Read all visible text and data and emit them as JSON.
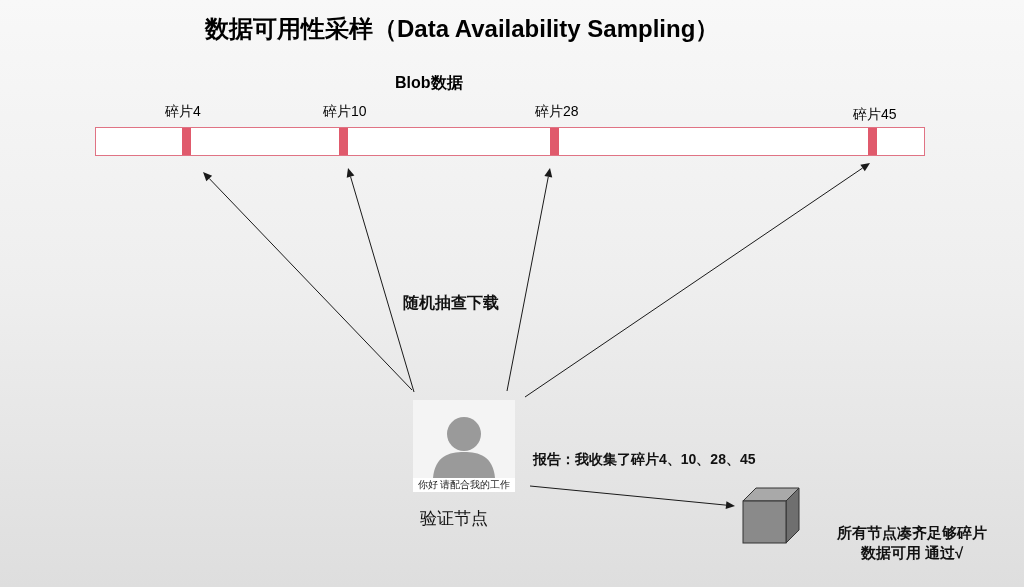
{
  "title": "数据可用性采样（Data Availability Sampling）",
  "blob": {
    "label": "Blob数据",
    "fragments": [
      {
        "label": "碎片4"
      },
      {
        "label": "碎片10"
      },
      {
        "label": "碎片28"
      },
      {
        "label": "碎片45"
      }
    ]
  },
  "sampling_label": "随机抽查下载",
  "node": {
    "caption": "你好 请配合我的工作",
    "label": "验证节点"
  },
  "report": "报告：我收集了碎片4、10、28、45",
  "conclusion": [
    "所有节点凑齐足够碎片",
    "数据可用 通过√"
  ]
}
